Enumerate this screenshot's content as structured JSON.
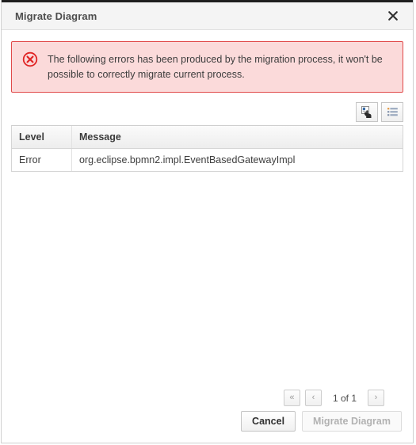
{
  "dialog": {
    "title": "Migrate Diagram",
    "close_icon": "close-icon"
  },
  "alert": {
    "icon": "error-circle-icon",
    "message": "The following errors has been produced by the migration process, it won't be possible to correctly migrate current process.",
    "background_color": "#fbdada",
    "border_color": "#e04a4a",
    "icon_color": "#e02424"
  },
  "toolbar": {
    "buttons": [
      {
        "name": "copy-to-clipboard-button",
        "icon": "copy-cursor-icon"
      },
      {
        "name": "list-view-button",
        "icon": "list-lines-icon"
      }
    ]
  },
  "table": {
    "columns": [
      "Level",
      "Message"
    ],
    "rows": [
      {
        "level": "Error",
        "message": "org.eclipse.bpmn2.impl.EventBasedGatewayImpl"
      }
    ]
  },
  "pager": {
    "first_label": "«",
    "prev_label": "‹",
    "status": "1 of 1",
    "next_label": "›"
  },
  "footer": {
    "cancel_label": "Cancel",
    "migrate_label": "Migrate Diagram"
  }
}
